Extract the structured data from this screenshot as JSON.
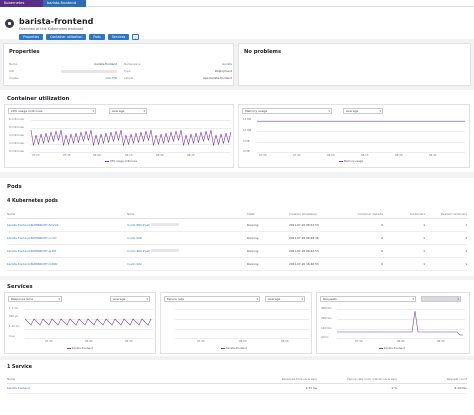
{
  "breadcrumb": {
    "items": [
      "Kubernetes workloads",
      "barista-frontend"
    ]
  },
  "header": {
    "title": "barista-frontend",
    "subtitle": "Overview of this Kubernetes workload",
    "tabs": [
      "Properties",
      "Container utilization",
      "Pods",
      "Services"
    ]
  },
  "properties": {
    "title": "Properties",
    "left": [
      {
        "key": "Name",
        "value": "barista-frontend"
      },
      {
        "key": "UID",
        "value": ""
      },
      {
        "key": "Cluster",
        "value": "cmk-TWI"
      }
    ],
    "right": [
      {
        "key": "Namespace",
        "value": "barista"
      },
      {
        "key": "Type",
        "value": "Deployment"
      },
      {
        "key": "Labels",
        "value": "app:barista-frontend"
      }
    ]
  },
  "problems": {
    "title": "No problems"
  },
  "container_utilization": {
    "title": "Container utilization",
    "cpu": {
      "metric": "CPU usage millicores",
      "agg": "Average",
      "yticks": [
        "8 millicores",
        "6 millicores",
        "4 millicores",
        "2 millicores",
        "0 millicores"
      ],
      "legend": "CPU usage millicores"
    },
    "mem": {
      "metric": "Memory usage",
      "agg": "Average",
      "yticks": [
        "13 MB",
        "10 MB",
        "5 MB",
        "0 MB"
      ],
      "legend": "Memory usage"
    },
    "xticks": [
      "07:30",
      "07:45",
      "08:00",
      "08:15",
      "08:30",
      "08:45"
    ]
  },
  "pods": {
    "title": "Pods",
    "subtitle": "4 Kubernetes pods",
    "columns": [
      "Name",
      "Node",
      "State",
      "Creation timestamp",
      "Container restarts",
      "Containers",
      "Desired containers"
    ],
    "rows": [
      [
        "barista-frontend-6b8866b9f7-fshxwb",
        "ln-sdc-984-9ywri",
        "Running",
        "2021-07-20 08:42:53",
        "0",
        "1",
        "1"
      ],
      [
        "barista-frontend-6b8866b9f7-ccr4d",
        "ln-sdc-920",
        "Running",
        "2021-07-20 08:48:36",
        "0",
        "1",
        "1"
      ],
      [
        "barista-frontend-6b8866b9f7-gr4ht",
        "ln-sdc-984-9ywri",
        "Running",
        "2021-07-20 08:42:53",
        "0",
        "1",
        "1"
      ],
      [
        "barista-frontend-6b8866b9f7-m49lk",
        "ln-sdc-922",
        "Running",
        "2021-07-20 16:40:53",
        "0",
        "1",
        "1"
      ]
    ]
  },
  "services": {
    "title": "Services",
    "charts": [
      {
        "metric": "Response time",
        "agg": "Average",
        "yticks": [
          "1.7 ms",
          "500 µs",
          "1.12 ms",
          "0 µs"
        ],
        "legend": "barista-frontend"
      },
      {
        "metric": "Failure rate",
        "agg": "Average",
        "yticks": [
          "",
          "",
          "",
          ""
        ],
        "legend": "barista-frontend"
      },
      {
        "metric": "Requests",
        "agg": "",
        "yticks": [
          "300/min",
          "200/min",
          "100/min",
          "0/min"
        ],
        "legend": "barista-frontend"
      }
    ],
    "xticks": [
      "07:30",
      "08:00",
      "08:30"
    ],
    "svc_title": "1 Service",
    "columns": [
      "Name",
      "Response time (Average)",
      "Failure rate (only critical) (Average)",
      "Request count"
    ],
    "rows": [
      [
        "barista-frontend",
        "2.73 ms",
        "0 %",
        "6.14/min"
      ]
    ]
  },
  "colors": {
    "accent": "#2b77c4",
    "series": "#7b3fa7",
    "breadcrumb": "#5a2d86"
  }
}
